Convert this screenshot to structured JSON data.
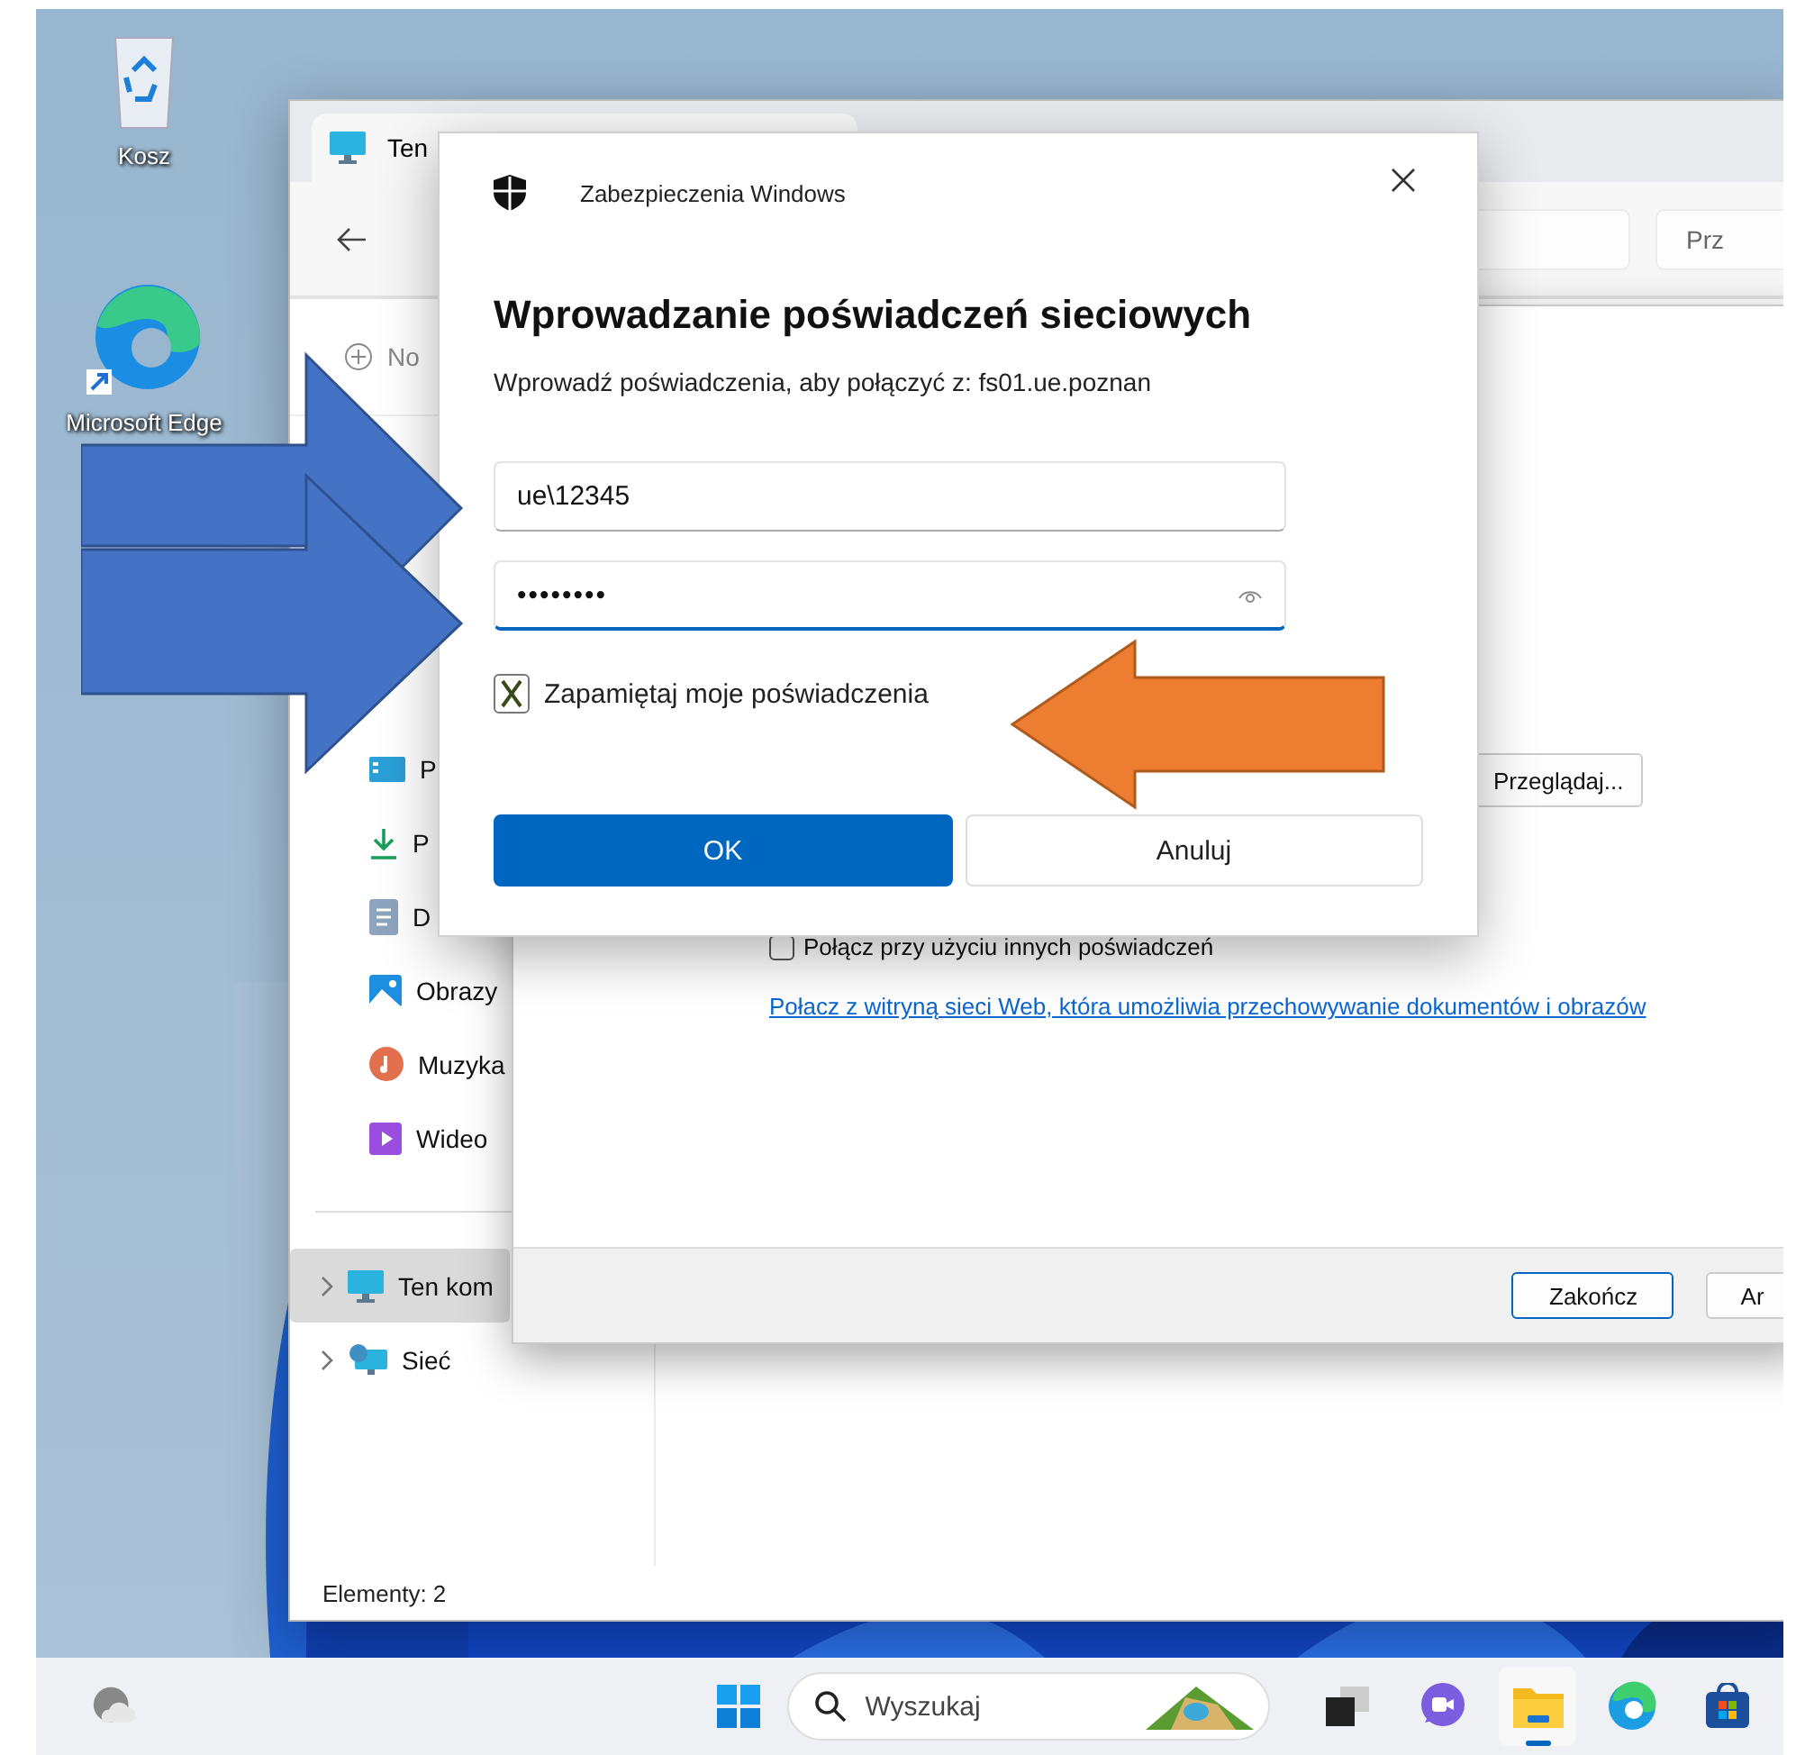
{
  "desktop_icons": [
    {
      "label": "Kosz"
    },
    {
      "label": "Microsoft Edge"
    }
  ],
  "explorer": {
    "tab_title": "Ten",
    "search_placeholder": "Prz",
    "new_button": "No",
    "quick_access": [
      {
        "label": "P"
      },
      {
        "label": "P"
      },
      {
        "label": "D"
      },
      {
        "label": "Obrazy"
      },
      {
        "label": "Muzyka"
      },
      {
        "label": "Wideo"
      }
    ],
    "tree": [
      {
        "label": "Ten kom",
        "selected": true,
        "expanded": false
      },
      {
        "label": "Sieć",
        "selected": false,
        "expanded": false
      }
    ],
    "status_bar": "Elementy: 2"
  },
  "map_drive_wizard": {
    "browse_button": "Przeglądaj...",
    "other_credentials": {
      "label": "Połącz przy użyciu innych poświadczeń",
      "checked": false
    },
    "link": "Połacz z witryną sieci Web, która umożliwia przechowywanie dokumentów i obrazów",
    "buttons": [
      {
        "label": "Zakończ",
        "default": true
      },
      {
        "label": "Ar",
        "default": false
      }
    ]
  },
  "credentials_dialog": {
    "app_title": "Zabezpieczenia Windows",
    "heading": "Wprowadzanie poświadczeń sieciowych",
    "description": "Wprowadź poświadczenia, aby połączyć z: fs01.ue.poznan",
    "username": {
      "value": "ue\\12345",
      "focused": false
    },
    "password": {
      "value": "••••••••",
      "focused": true
    },
    "remember": {
      "label": "Zapamiętaj moje poświadczenia",
      "checked": true
    },
    "buttons": [
      {
        "label": "OK",
        "primary": true
      },
      {
        "label": "Anuluj",
        "primary": false
      }
    ]
  },
  "annotations": [
    {
      "kind": "right-arrow",
      "color": "#4472c4"
    },
    {
      "kind": "right-arrow",
      "color": "#4472c4"
    },
    {
      "kind": "left-arrow",
      "color": "#ed7d31"
    }
  ],
  "taskbar": {
    "search_placeholder": "Wyszukaj",
    "apps": [
      {
        "kind": "task-view",
        "active": false
      },
      {
        "kind": "chat",
        "active": false
      },
      {
        "kind": "file-explorer",
        "active": true
      },
      {
        "kind": "edge",
        "active": false
      },
      {
        "kind": "store",
        "active": false
      }
    ]
  }
}
